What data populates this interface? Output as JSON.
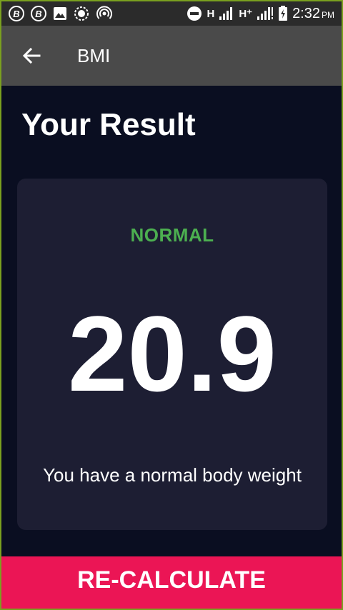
{
  "status_bar": {
    "time": "2:32",
    "ampm": "PM",
    "network_1": "H",
    "network_2": "H⁺",
    "icons": [
      "b-coin-icon",
      "b-coin-icon",
      "image-icon",
      "sync-icon",
      "hotspot-icon",
      "do-not-disturb-icon",
      "signal-icon",
      "signal-icon",
      "battery-charging-icon"
    ]
  },
  "app_bar": {
    "title": "BMI",
    "back_icon": "arrow-back-icon"
  },
  "result": {
    "heading": "Your Result",
    "status": "NORMAL",
    "bmi": "20.9",
    "message": "You have a normal body weight"
  },
  "action": {
    "label": "RE-CALCULATE"
  },
  "colors": {
    "background": "#0a0e21",
    "card": "#1d1e33",
    "status_text": "#4caf50",
    "accent": "#eb1555",
    "app_bar": "#4a4a4a"
  }
}
